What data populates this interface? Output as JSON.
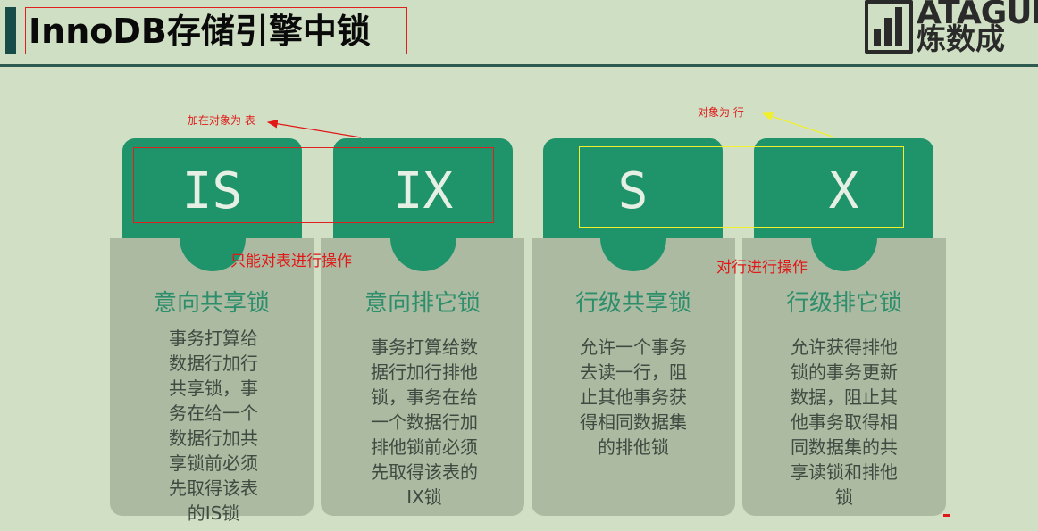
{
  "slide": {
    "title": "InnoDB存储引擎中锁",
    "logo": {
      "top_text": "ATAGUI",
      "bottom_text": "炼数成"
    }
  },
  "locks": [
    {
      "letter": "IS",
      "name": "意向共享锁",
      "description_lines": [
        "事务打算给",
        "数据行加行",
        "共享锁，事",
        "务在给一个",
        "数据行加共",
        "享锁前必须",
        "先取得该表",
        "的IS锁"
      ]
    },
    {
      "letter": "IX",
      "name": "意向排它锁",
      "description_lines": [
        "事务打算给数",
        "据行加行排他",
        "锁，事务在给",
        "一个数据行加",
        "排他锁前必须",
        "先取得该表的",
        "IX锁"
      ]
    },
    {
      "letter": "S",
      "name": "行级共享锁",
      "description_lines": [
        "允许一个事务",
        "去读一行，阻",
        "止其他事务获",
        "得相同数据集",
        "的排他锁"
      ]
    },
    {
      "letter": "X",
      "name": "行级排它锁",
      "description_lines": [
        "允许获得排他",
        "锁的事务更新",
        "数据，阻止其",
        "他事务取得相",
        "同数据集的共",
        "享读锁和排他",
        "锁"
      ]
    }
  ],
  "annotations": {
    "table_target": "加在对象为 表",
    "table_only": "只能对表进行操作",
    "row_target": "对象为 行",
    "row_ops": "对行进行操作"
  },
  "colors": {
    "background": "#d1dfc4",
    "tab_green": "#1f946b",
    "card_gray": "#adbaa2",
    "title_green": "#2c8e6b",
    "annotation_red": "#e01818",
    "annotation_yellow": "#f2f02a"
  }
}
